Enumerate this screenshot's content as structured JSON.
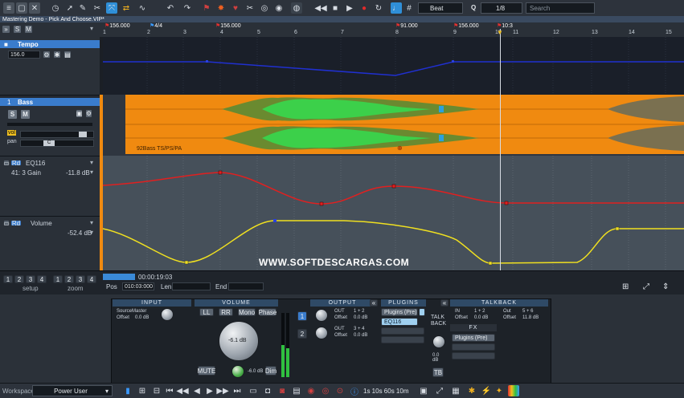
{
  "window": {
    "title": "Mastering Demo - Pick And Choose.VIP*"
  },
  "toolbar": {
    "snap_value": "Beat",
    "quantize_value": "1/8",
    "search_placeholder": "Search",
    "q_label": "Q"
  },
  "ruler": {
    "markers": [
      "156.000",
      "4/4",
      "156.000",
      "91.000",
      "156.000",
      "10:3"
    ],
    "bars": [
      "1",
      "2",
      "3",
      "4",
      "5",
      "6",
      "7",
      "8",
      "9",
      "10",
      "11",
      "12",
      "13",
      "14",
      "15"
    ]
  },
  "tempo_track": {
    "name": "Tempo",
    "value": "156.0"
  },
  "bass_track": {
    "number": "1",
    "name": "Bass",
    "solo_label": "S",
    "mute_label": "M",
    "vol_label": "vol",
    "pan_label": "pan",
    "pan_value": "C",
    "clip_name": "92Bass  TS/PS/PA"
  },
  "eq_lane": {
    "name": "EQ116",
    "param": "41: 3 Gain",
    "value": "-11.8 dB"
  },
  "vol_lane": {
    "name": "Volume",
    "value": "-52.4 dB"
  },
  "status": {
    "time": "00:00:19:03",
    "pos_label": "Pos",
    "pos_value": "010:03:000",
    "len_label": "Len",
    "end_label": "End",
    "setup_label": "setup",
    "zoom_label": "zoom"
  },
  "console": {
    "input": {
      "header": "INPUT",
      "source_label": "Source",
      "source_value": "Master",
      "offset_label": "Offset",
      "offset_value": "0.0 dB"
    },
    "volume": {
      "header": "VOLUME",
      "ll": "LL",
      "rr": "RR",
      "mono": "Mono",
      "phase": "Phase",
      "knob_value": "-6.1 dB",
      "mute": "MUTE",
      "dim_value": "-6.0 dB",
      "dim": "Dim"
    },
    "output": {
      "header": "OUTPUT",
      "ch1": "1",
      "ch2": "2",
      "out_label": "OUT",
      "out1_value": "1 + 2",
      "offset1_value": "0.0 dB",
      "out2_value": "3 + 4",
      "offset2_value": "0.0 dB",
      "offset_label": "Offset"
    },
    "plugins": {
      "header": "PLUGINS",
      "slot1": "Plugins (Pre)",
      "slot2": "EQ116"
    },
    "talkback": {
      "header": "TALKBACK",
      "label": "TALK BACK",
      "in_label": "IN",
      "in_value": "1 + 2",
      "out_label": "Out",
      "out_value": "5 + 6",
      "offset_label": "Offset",
      "offset_in": "0.0 dB",
      "offset_out": "11.8 dB",
      "fx_label": "FX",
      "fx_slot": "Plugins (Pre)",
      "level": "0.0 dB",
      "tb": "TB"
    }
  },
  "footer": {
    "workspace_label": "Workspace:",
    "workspace_value": "Power User",
    "counters": "1s 10s 60s 10m"
  },
  "watermark": "WWW.SOFTDESCARGAS.COM",
  "colors": {
    "clip": "#f08a10",
    "tempo_line": "#2030d0",
    "eq_line": "#e02020",
    "vol_line": "#f0e020",
    "accent": "#3a7ccc"
  }
}
